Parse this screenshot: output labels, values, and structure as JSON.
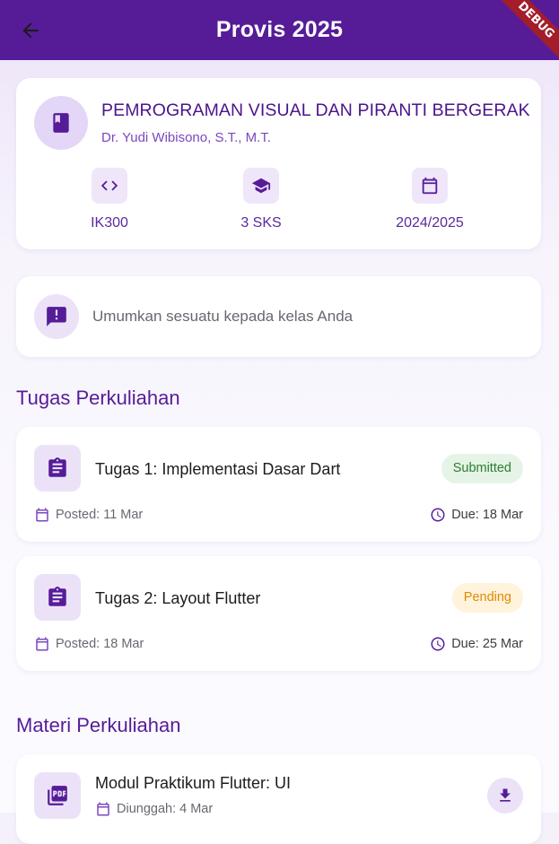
{
  "appbar": {
    "title": "Provis 2025",
    "debug_label": "DEBUG"
  },
  "course": {
    "title": "PEMROGRAMAN VISUAL DAN PIRANTI BERGERAK",
    "lecturer": "Dr. Yudi Wibisono, S.T., M.T.",
    "code": "IK300",
    "credits": "3 SKS",
    "year": "2024/2025"
  },
  "announcement": {
    "placeholder": "Umumkan sesuatu kepada kelas Anda"
  },
  "tasks_section": {
    "title": "Tugas Perkuliahan",
    "items": [
      {
        "title": "Tugas 1: Implementasi Dasar Dart",
        "status": "Submitted",
        "posted": "Posted: 11 Mar",
        "due": "Due: 18 Mar"
      },
      {
        "title": "Tugas 2: Layout Flutter",
        "status": "Pending",
        "posted": "Posted: 18 Mar",
        "due": "Due: 25 Mar"
      }
    ]
  },
  "materials_section": {
    "title": "Materi Perkuliahan",
    "items": [
      {
        "title": "Modul Praktikum Flutter: UI",
        "uploaded": "Diunggah: 4 Mar"
      }
    ]
  },
  "colors": {
    "appbar": "#561c98",
    "accent": "#4a148c",
    "submitted": "#2e7d32",
    "pending": "#e08a00",
    "debug_banner": "#a31d2a"
  },
  "icons": {
    "back": "arrow-left-icon",
    "course": "book-icon",
    "code": "code-icon",
    "credits": "graduation-cap-icon",
    "year": "calendar-icon",
    "announcement": "announcement-icon",
    "task": "assignment-icon",
    "posted": "calendar-icon",
    "due": "clock-icon",
    "material": "pdf-icon",
    "download": "download-icon"
  }
}
